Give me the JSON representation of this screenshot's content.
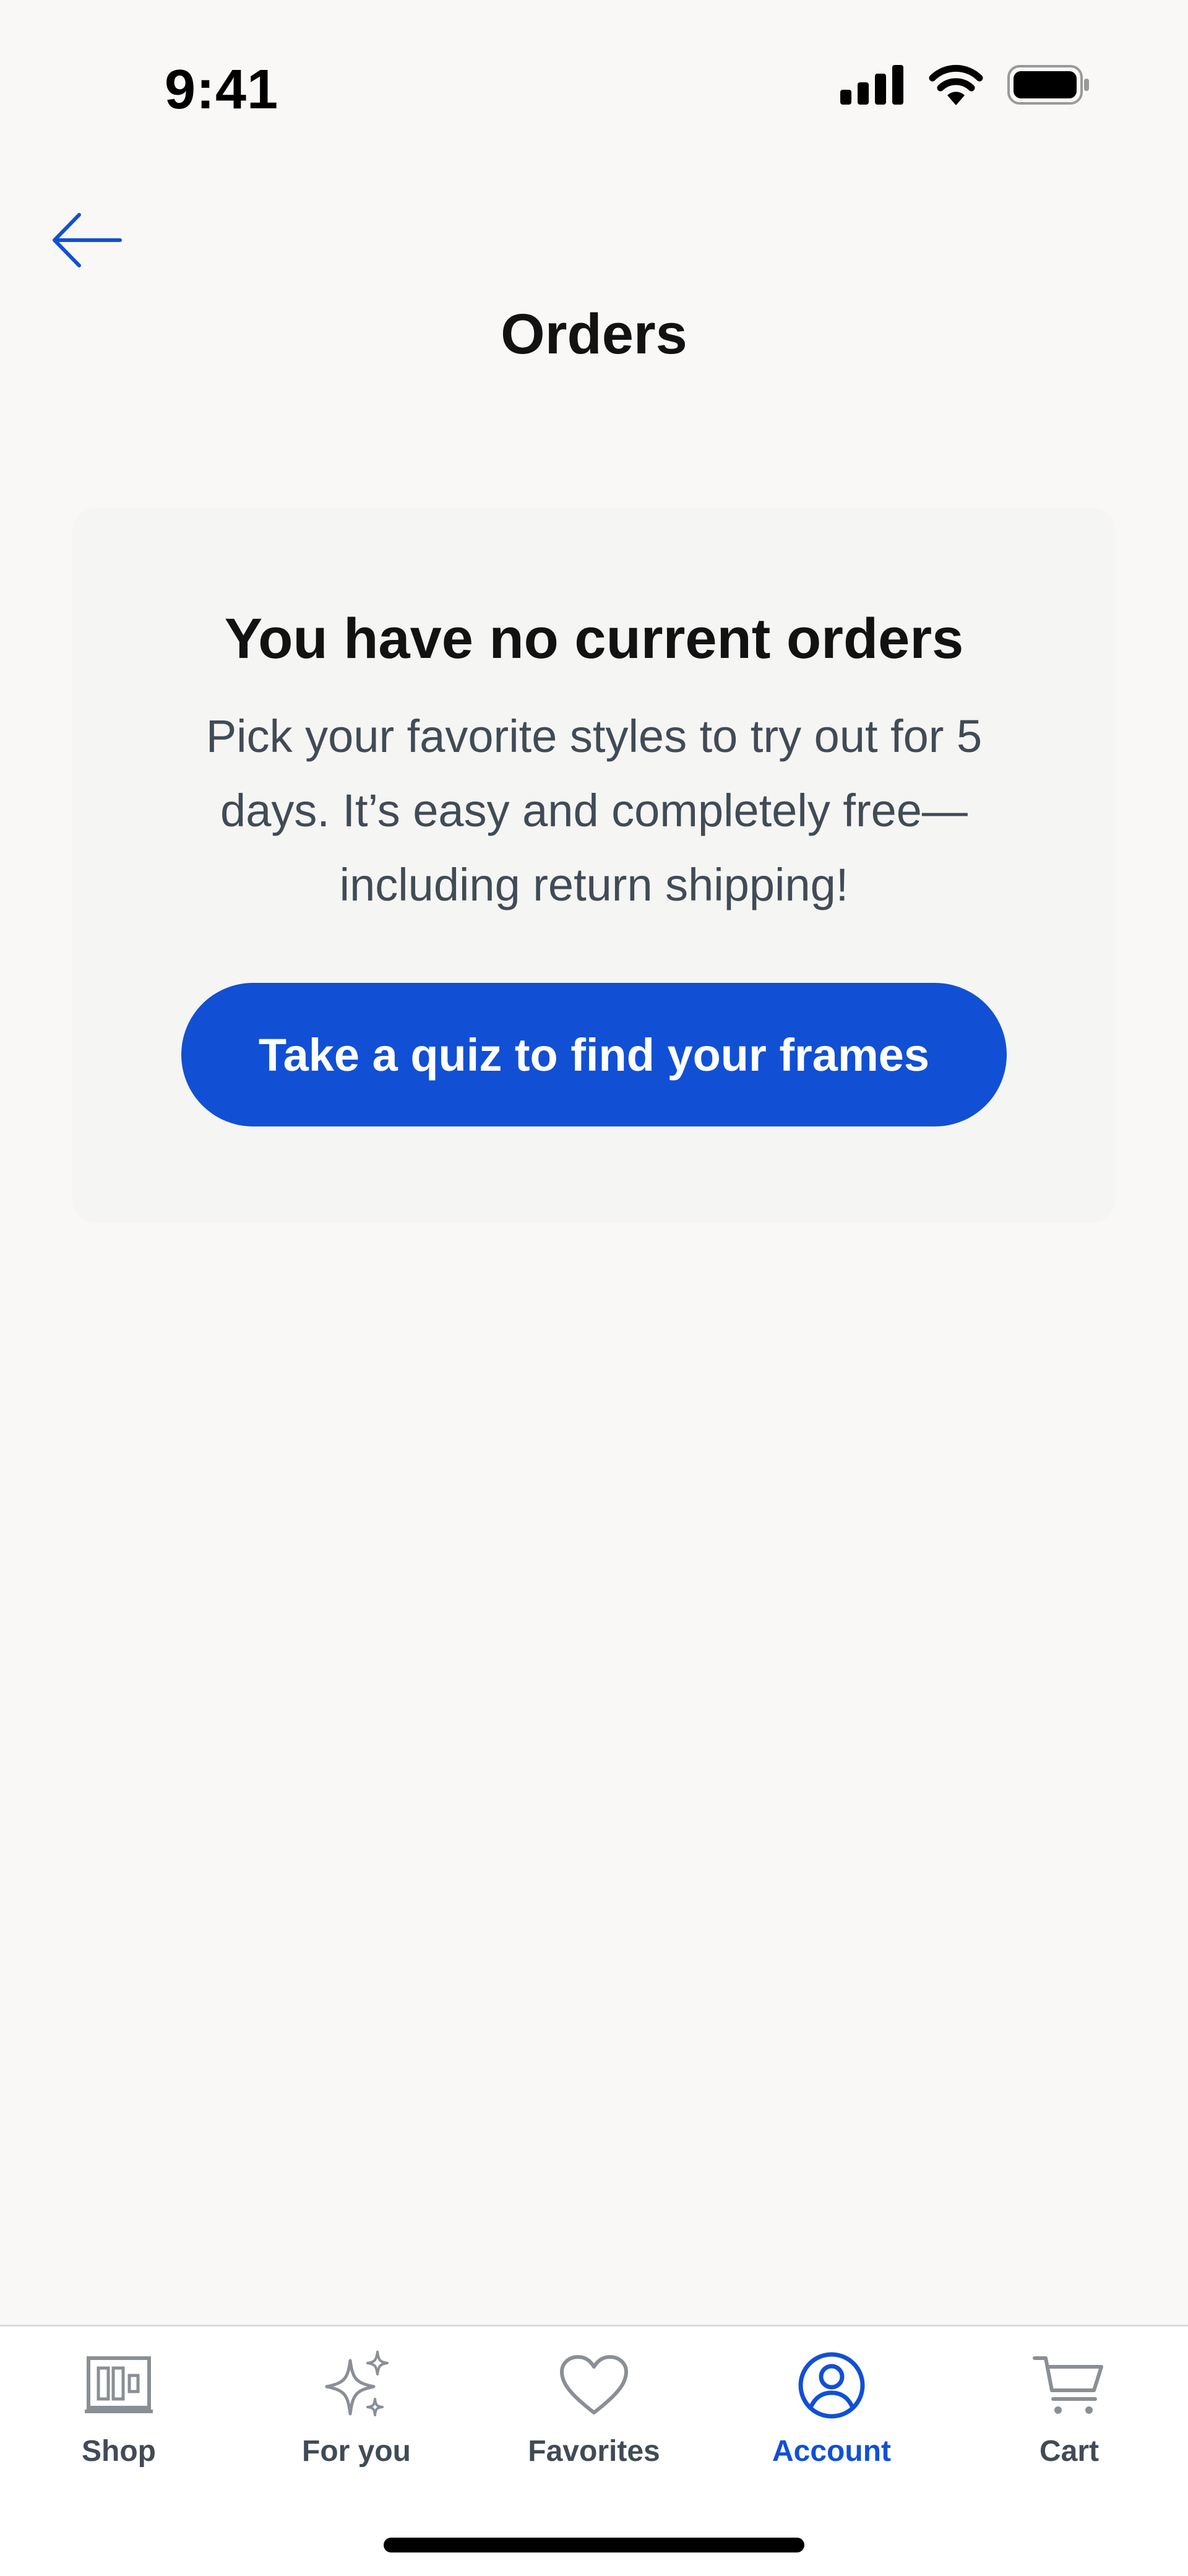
{
  "status_bar": {
    "time": "9:41",
    "icons": [
      "cellular-signal-icon",
      "wifi-icon",
      "battery-icon"
    ]
  },
  "header": {
    "back_icon": "arrow-left-icon",
    "title": "Orders"
  },
  "empty_state": {
    "heading": "You have no current orders",
    "body": "Pick your favorite styles to try out for 5 days. It’s easy and completely free—including return shipping!",
    "cta_label": "Take a quiz to find your frames"
  },
  "tab_bar": {
    "items": [
      {
        "label": "Shop",
        "icon": "shop-icon",
        "active": false
      },
      {
        "label": "For you",
        "icon": "sparkles-icon",
        "active": false
      },
      {
        "label": "Favorites",
        "icon": "heart-icon",
        "active": false
      },
      {
        "label": "Account",
        "icon": "account-icon",
        "active": true
      },
      {
        "label": "Cart",
        "icon": "cart-icon",
        "active": false
      }
    ]
  },
  "colors": {
    "background": "#f9f8f6",
    "card": "#f5f5f4",
    "primary": "#1150d4",
    "text": "#121212",
    "muted_text": "#414b56",
    "inactive_icon": "#8a8f96"
  }
}
